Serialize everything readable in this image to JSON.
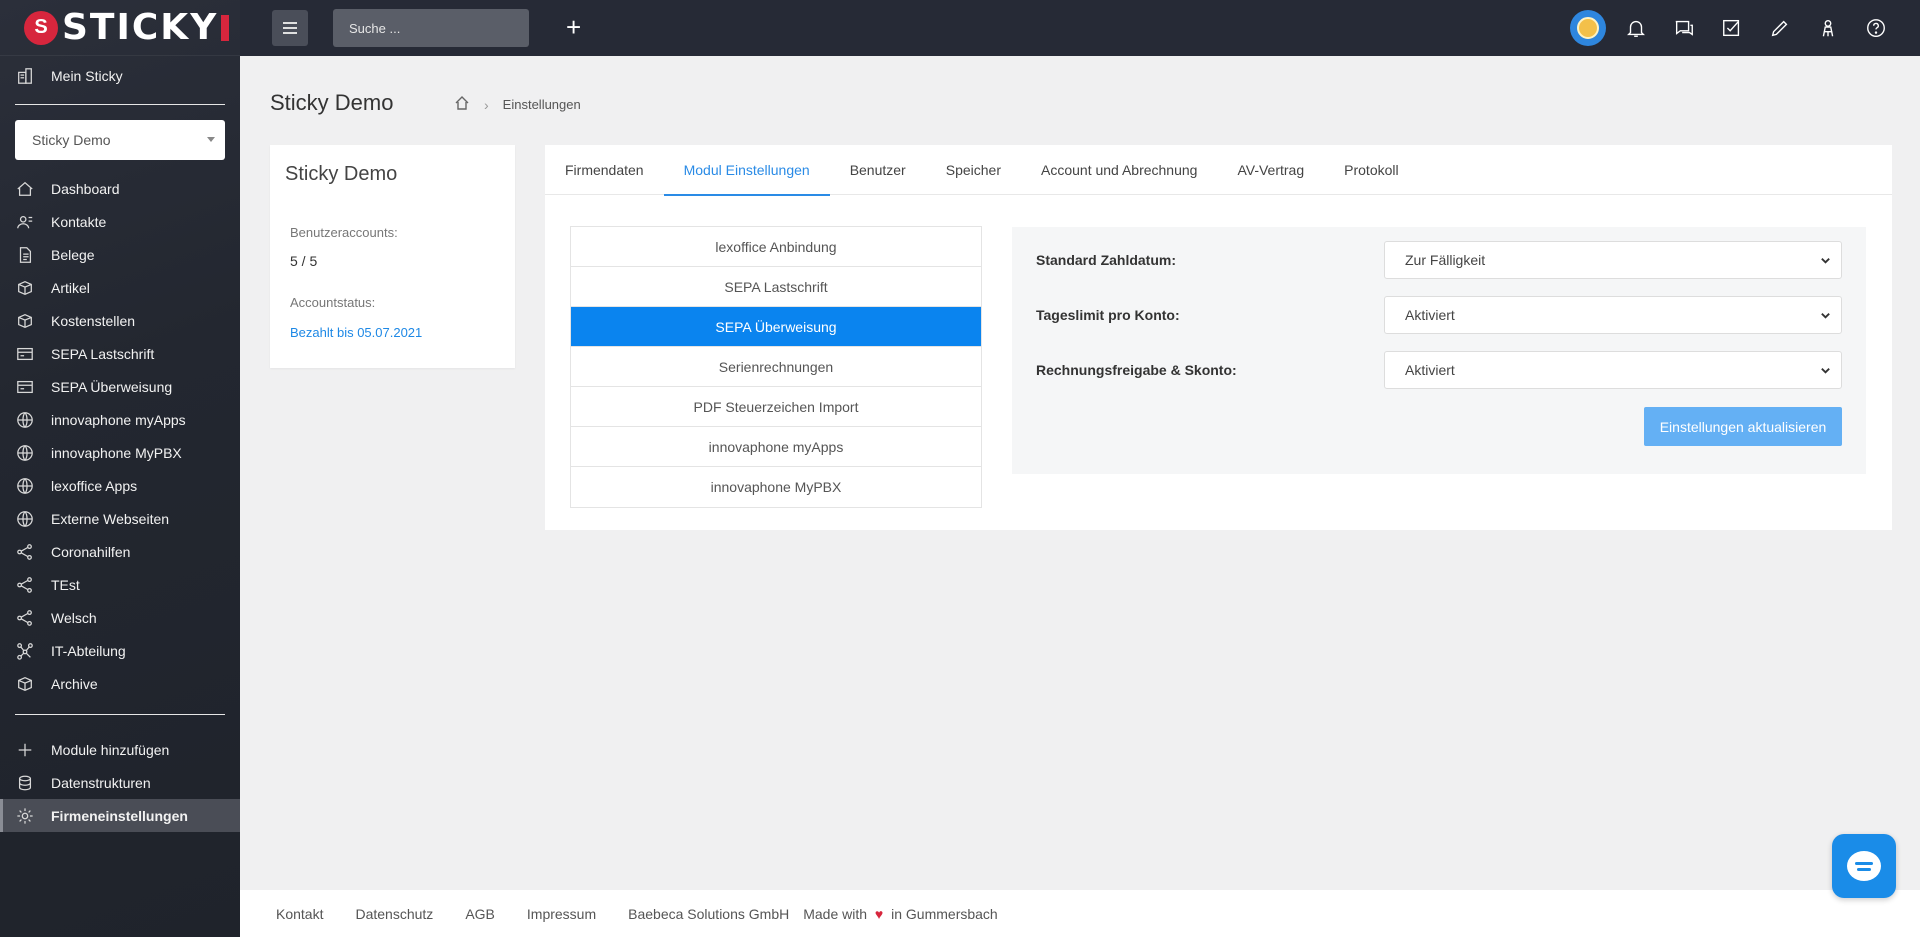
{
  "app": {
    "logo_text": "STICKY"
  },
  "sidebar": {
    "top_item": "Mein Sticky",
    "company_select": "Sticky Demo",
    "items": [
      {
        "label": "Dashboard",
        "icon": "home-icon"
      },
      {
        "label": "Kontakte",
        "icon": "contacts-icon"
      },
      {
        "label": "Belege",
        "icon": "document-icon"
      },
      {
        "label": "Artikel",
        "icon": "box-icon"
      },
      {
        "label": "Kostenstellen",
        "icon": "box-icon"
      },
      {
        "label": "SEPA Lastschrift",
        "icon": "card-icon"
      },
      {
        "label": "SEPA Überweisung",
        "icon": "card-icon"
      },
      {
        "label": "innovaphone myApps",
        "icon": "globe-icon"
      },
      {
        "label": "innovaphone MyPBX",
        "icon": "globe-icon"
      },
      {
        "label": "lexoffice Apps",
        "icon": "globe-icon"
      },
      {
        "label": "Externe Webseiten",
        "icon": "globe-icon"
      },
      {
        "label": "Coronahilfen",
        "icon": "share-icon"
      },
      {
        "label": "TEst",
        "icon": "share-icon"
      },
      {
        "label": "Welsch",
        "icon": "share-icon"
      },
      {
        "label": "IT-Abteilung",
        "icon": "network-icon"
      },
      {
        "label": "Archive",
        "icon": "box-icon"
      }
    ],
    "bottom_items": [
      {
        "label": "Module hinzufügen",
        "icon": "plus-icon"
      },
      {
        "label": "Datenstrukturen",
        "icon": "database-icon"
      },
      {
        "label": "Firmeneinstellungen",
        "icon": "gear-icon"
      }
    ]
  },
  "topbar": {
    "search_placeholder": "Suche ...",
    "plus": "+"
  },
  "page": {
    "title": "Sticky Demo",
    "breadcrumb": "Einstellungen"
  },
  "info_card": {
    "title": "Sticky Demo",
    "accounts_label": "Benutzeraccounts:",
    "accounts_value": "5 / 5",
    "status_label": "Accountstatus:",
    "status_value": "Bezahlt bis 05.07.2021"
  },
  "tabs": [
    "Firmendaten",
    "Modul Einstellungen",
    "Benutzer",
    "Speicher",
    "Account und Abrechnung",
    "AV-Vertrag",
    "Protokoll"
  ],
  "modules": [
    "lexoffice Anbindung",
    "SEPA Lastschrift",
    "SEPA Überweisung",
    "Serienrechnungen",
    "PDF Steuerzeichen Import",
    "innovaphone myApps",
    "innovaphone MyPBX"
  ],
  "settings": {
    "rows": [
      {
        "label": "Standard Zahldatum:",
        "value": "Zur Fälligkeit"
      },
      {
        "label": "Tageslimit pro Konto:",
        "value": "Aktiviert"
      },
      {
        "label": "Rechnungsfreigabe & Skonto:",
        "value": "Aktiviert"
      }
    ],
    "update_button": "Einstellungen aktualisieren"
  },
  "footer": {
    "links": [
      "Kontakt",
      "Datenschutz",
      "AGB",
      "Impressum",
      "Baebeca Solutions GmbH"
    ],
    "made_prefix": "Made with",
    "heart": "♥",
    "made_suffix": "in Gummersbach"
  },
  "colors": {
    "accent": "#0a84ef",
    "sidebar_bg": "#262a36",
    "brand_red": "#d7263d"
  }
}
